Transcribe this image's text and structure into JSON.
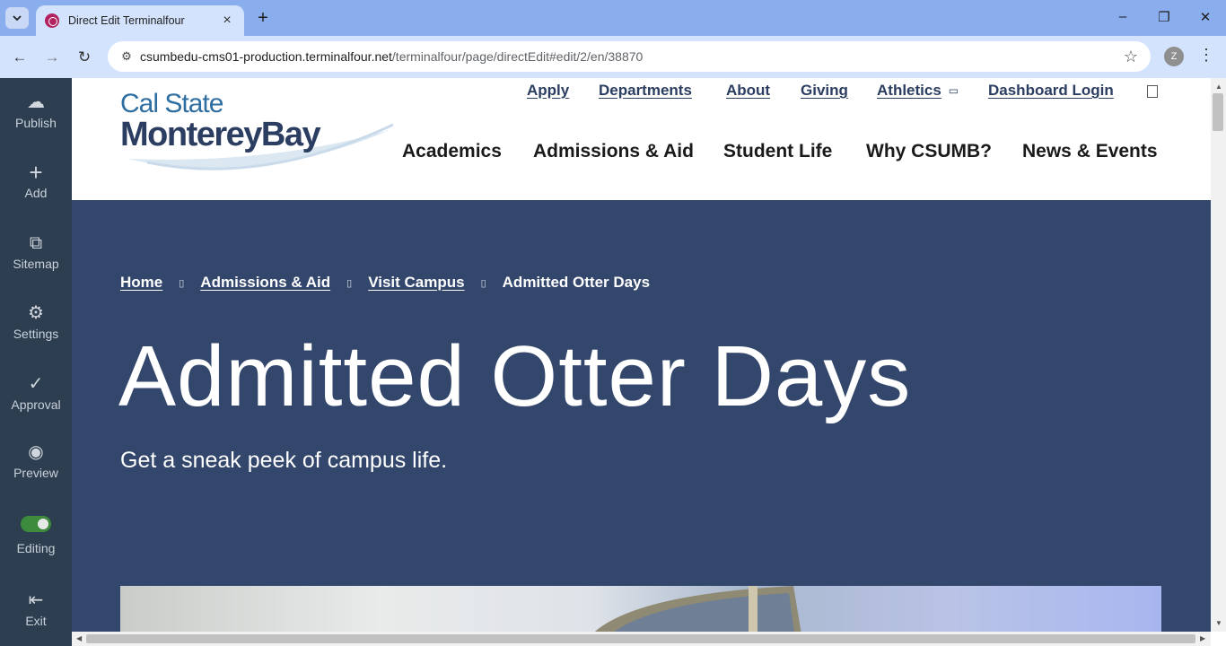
{
  "browser": {
    "tab_title": "Direct Edit Terminalfour",
    "url_host": "csumbedu-cms01-production.terminalfour.net",
    "url_path": "/terminalfour/page/directEdit#edit/2/en/38870",
    "profile_initial": "Z",
    "icons": {
      "tab_list": "chevron-down",
      "tab_close": "×",
      "new_tab": "+",
      "minimize": "–",
      "restore": "❐",
      "close_window": "✕",
      "back": "←",
      "forward": "→",
      "reload": "↻",
      "site_info": "⚙",
      "bookmark": "☆",
      "menu": "⋮"
    }
  },
  "sidebar": {
    "items": [
      {
        "label": "Publish",
        "icon": "cloud-upload-icon",
        "glyph": "☁"
      },
      {
        "label": "Add",
        "icon": "plus-icon",
        "glyph": "+"
      },
      {
        "label": "Sitemap",
        "icon": "sitemap-icon",
        "glyph": "⧉"
      },
      {
        "label": "Settings",
        "icon": "gear-icon",
        "glyph": "⚙"
      },
      {
        "label": "Approval",
        "icon": "check-icon",
        "glyph": "✓"
      },
      {
        "label": "Preview",
        "icon": "eye-icon",
        "glyph": "◉"
      },
      {
        "label": "Editing",
        "icon": "toggle-switch",
        "glyph": "",
        "toggle_on": true
      },
      {
        "label": "Exit",
        "icon": "exit-icon",
        "glyph": "⇤"
      }
    ]
  },
  "site": {
    "logo": {
      "line1": "Cal State",
      "line2": "MontereyBay"
    },
    "utility_nav": [
      "Apply",
      "Departments",
      "About",
      "Giving",
      "Athletics",
      "Dashboard Login"
    ],
    "main_nav": [
      "Academics",
      "Admissions & Aid",
      "Student Life",
      "Why CSUMB?",
      "News & Events"
    ],
    "breadcrumbs": [
      "Home",
      "Admissions & Aid",
      "Visit Campus"
    ],
    "breadcrumb_current": "Admitted Otter Days",
    "hero_title": "Admitted Otter Days",
    "hero_subtitle": "Get a sneak peek of campus life."
  },
  "colors": {
    "hero_bg": "#33466c",
    "sidebar_bg": "#2c3e50",
    "brand_navy": "#2b3d60",
    "brand_blue": "#2e6ea1",
    "toggle_on": "#3d8b3d"
  }
}
